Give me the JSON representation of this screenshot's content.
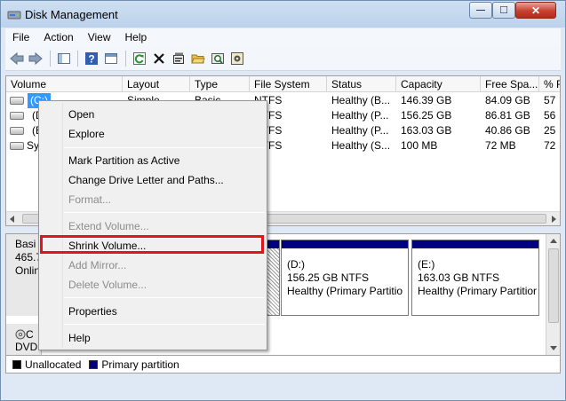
{
  "window": {
    "title": "Disk Management",
    "controls": {
      "minimize": "—",
      "maximize": "☐",
      "close": "✕"
    }
  },
  "menu": [
    "File",
    "Action",
    "View",
    "Help"
  ],
  "toolbar": {
    "icons": [
      "back-icon",
      "forward-icon",
      "console-tree-icon",
      "help-icon",
      "console-icon",
      "refresh-icon",
      "delete-icon",
      "properties-icon",
      "open-folder-icon",
      "find-icon",
      "disk-properties-icon"
    ]
  },
  "volumes": {
    "columns": [
      "Volume",
      "Layout",
      "Type",
      "File System",
      "Status",
      "Capacity",
      "Free Spa...",
      "% F"
    ],
    "rows": [
      {
        "volume": "(C:)",
        "layout": "Simple",
        "type": "Basic",
        "fs": "NTFS",
        "status": "Healthy (B...",
        "capacity": "146.39 GB",
        "free": "84.09 GB",
        "pct": "57"
      },
      {
        "volume": "(D",
        "layout": "",
        "type": "",
        "fs": "NTFS",
        "status": "Healthy (P...",
        "capacity": "156.25 GB",
        "free": "86.81 GB",
        "pct": "56"
      },
      {
        "volume": "(E",
        "layout": "",
        "type": "",
        "fs": "NTFS",
        "status": "Healthy (P...",
        "capacity": "163.03 GB",
        "free": "40.86 GB",
        "pct": "25"
      },
      {
        "volume": "Sys",
        "layout": "",
        "type": "",
        "fs": "NTFS",
        "status": "Healthy (S...",
        "capacity": "100 MB",
        "free": "72 MB",
        "pct": "72"
      }
    ]
  },
  "disks": {
    "disk0": {
      "line1": "Basi",
      "line2": "465.7",
      "line3": "Onlin"
    },
    "partitions": [
      {
        "name": "(D:)",
        "size": "156.25 GB NTFS",
        "status": "Healthy (Primary Partitio"
      },
      {
        "name": "(E:)",
        "size": "163.03 GB NTFS",
        "status": "Healthy (Primary Partitior"
      }
    ],
    "disk1": {
      "line1": "C",
      "line2": "DVD (F:)"
    }
  },
  "legend": {
    "unallocated": "Unallocated",
    "primary": "Primary partition",
    "colors": {
      "unallocated": "#000000",
      "primary": "#000080"
    }
  },
  "context_menu": {
    "open": "Open",
    "explore": "Explore",
    "mark_active": "Mark Partition as Active",
    "change_letter": "Change Drive Letter and Paths...",
    "format": "Format...",
    "extend": "Extend Volume...",
    "shrink": "Shrink Volume...",
    "add_mirror": "Add Mirror...",
    "delete": "Delete Volume...",
    "properties": "Properties",
    "help": "Help"
  },
  "highlight_color": "#e1141f"
}
